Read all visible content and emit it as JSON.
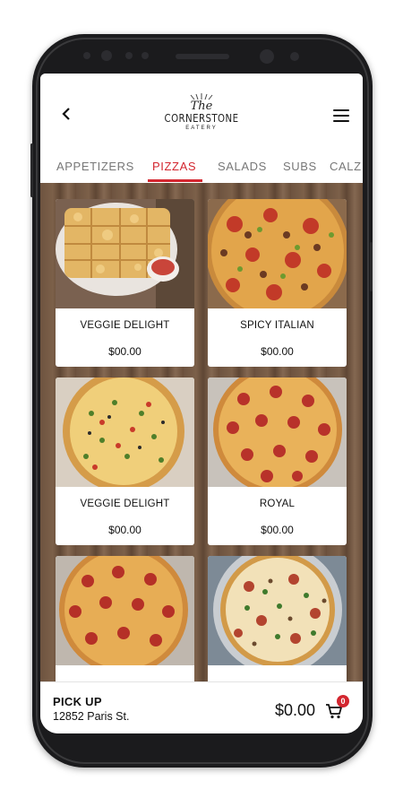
{
  "app": {
    "logo": {
      "line1": "The",
      "line2": "CORNERSTONE",
      "line3": "EATERY"
    }
  },
  "header": {
    "back_icon": "chevron-left-icon",
    "menu_icon": "hamburger-menu-icon"
  },
  "tabs": [
    {
      "label": "APPETIZERS",
      "active": false
    },
    {
      "label": "PIZZAS",
      "active": true
    },
    {
      "label": "SALADS",
      "active": false
    },
    {
      "label": "SUBS",
      "active": false
    },
    {
      "label": "CALZ",
      "active": false
    }
  ],
  "menu_items": [
    {
      "name": "VEGGIE DELIGHT",
      "price": "$00.00",
      "image": "garlic-breadsticks-photo"
    },
    {
      "name": "SPICY ITALIAN",
      "price": "$00.00",
      "image": "spicy-italian-pizza-photo"
    },
    {
      "name": "VEGGIE DELIGHT",
      "price": "$00.00",
      "image": "veggie-pizza-photo"
    },
    {
      "name": "ROYAL",
      "price": "$00.00",
      "image": "pepperoni-pizza-photo"
    },
    {
      "name": "",
      "price": "",
      "image": "pepperoni-pizza-photo"
    },
    {
      "name": "",
      "price": "",
      "image": "supreme-pizza-photo"
    }
  ],
  "order": {
    "mode": "PICK UP",
    "address": "12852 Paris St.",
    "total": "$0.00",
    "cart_count": "0",
    "cart_icon": "shopping-cart-icon"
  },
  "colors": {
    "accent": "#d3262f",
    "text": "#111111",
    "wood": "#6e5440"
  }
}
